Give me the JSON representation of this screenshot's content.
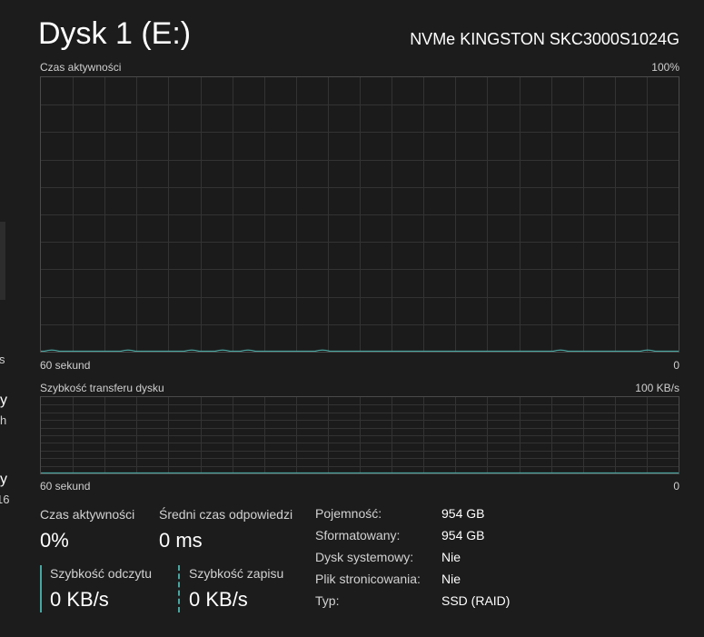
{
  "header": {
    "title": "Dysk 1 (E:)",
    "model": "NVMe KINGSTON SKC3000S1024G"
  },
  "left_fragments": [
    "s",
    "y",
    "h",
    "y",
    "16"
  ],
  "activity_graph": {
    "label": "Czas aktywności",
    "max": "100%",
    "time_label": "60 sekund",
    "min": "0"
  },
  "transfer_graph": {
    "label": "Szybkość transferu dysku",
    "max": "100 KB/s",
    "time_label": "60 sekund",
    "min": "0"
  },
  "stats": {
    "active_time_label": "Czas aktywności",
    "active_time_value": "0%",
    "response_label": "Średni czas odpowiedzi",
    "response_value": "0 ms",
    "read_label": "Szybkość odczytu",
    "read_value": "0 KB/s",
    "write_label": "Szybkość zapisu",
    "write_value": "0 KB/s"
  },
  "properties": [
    {
      "label": "Pojemność:",
      "value": "954 GB"
    },
    {
      "label": "Sformatowany:",
      "value": "954 GB"
    },
    {
      "label": "Dysk systemowy:",
      "value": "Nie"
    },
    {
      "label": "Plik stronicowania:",
      "value": "Nie"
    },
    {
      "label": "Typ:",
      "value": "SSD (RAID)"
    }
  ],
  "colors": {
    "background": "#1c1c1c",
    "grid": "#333333",
    "graph_border": "#4a4a4a",
    "accent": "#4aa5a0"
  }
}
